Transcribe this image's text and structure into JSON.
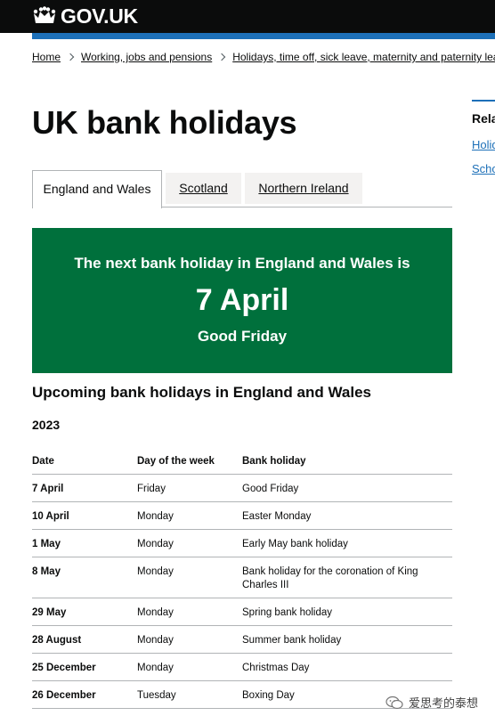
{
  "header": {
    "logo_text": "GOV.UK",
    "logo_icon": "crown-icon"
  },
  "breadcrumb": [
    "Home",
    "Working, jobs and pensions",
    "Holidays, time off, sick leave, maternity and paternity leave"
  ],
  "page_title": "UK bank holidays",
  "related": {
    "heading": "Rela",
    "links": [
      "Holid",
      "Scho"
    ]
  },
  "tabs": [
    "England and Wales",
    "Scotland",
    "Northern Ireland"
  ],
  "active_tab": "England and Wales",
  "next_holiday": {
    "intro": "The next bank holiday in England and Wales is",
    "date": "7 April",
    "name": "Good Friday"
  },
  "upcoming_heading": "Upcoming bank holidays in England and Wales",
  "year": "2023",
  "table": {
    "headers": [
      "Date",
      "Day of the week",
      "Bank holiday"
    ],
    "rows": [
      [
        "7 April",
        "Friday",
        "Good Friday"
      ],
      [
        "10 April",
        "Monday",
        "Easter Monday"
      ],
      [
        "1 May",
        "Monday",
        "Early May bank holiday"
      ],
      [
        "8 May",
        "Monday",
        "Bank holiday for the coronation of King Charles III"
      ],
      [
        "29 May",
        "Monday",
        "Spring bank holiday"
      ],
      [
        "28 August",
        "Monday",
        "Summer bank holiday"
      ],
      [
        "25 December",
        "Monday",
        "Christmas Day"
      ],
      [
        "26 December",
        "Tuesday",
        "Boxing Day"
      ]
    ]
  },
  "watermark": "爱思考的泰想",
  "colors": {
    "header": "#0b0c0c",
    "accent_blue": "#1d70b8",
    "panel_green": "#00703c"
  }
}
